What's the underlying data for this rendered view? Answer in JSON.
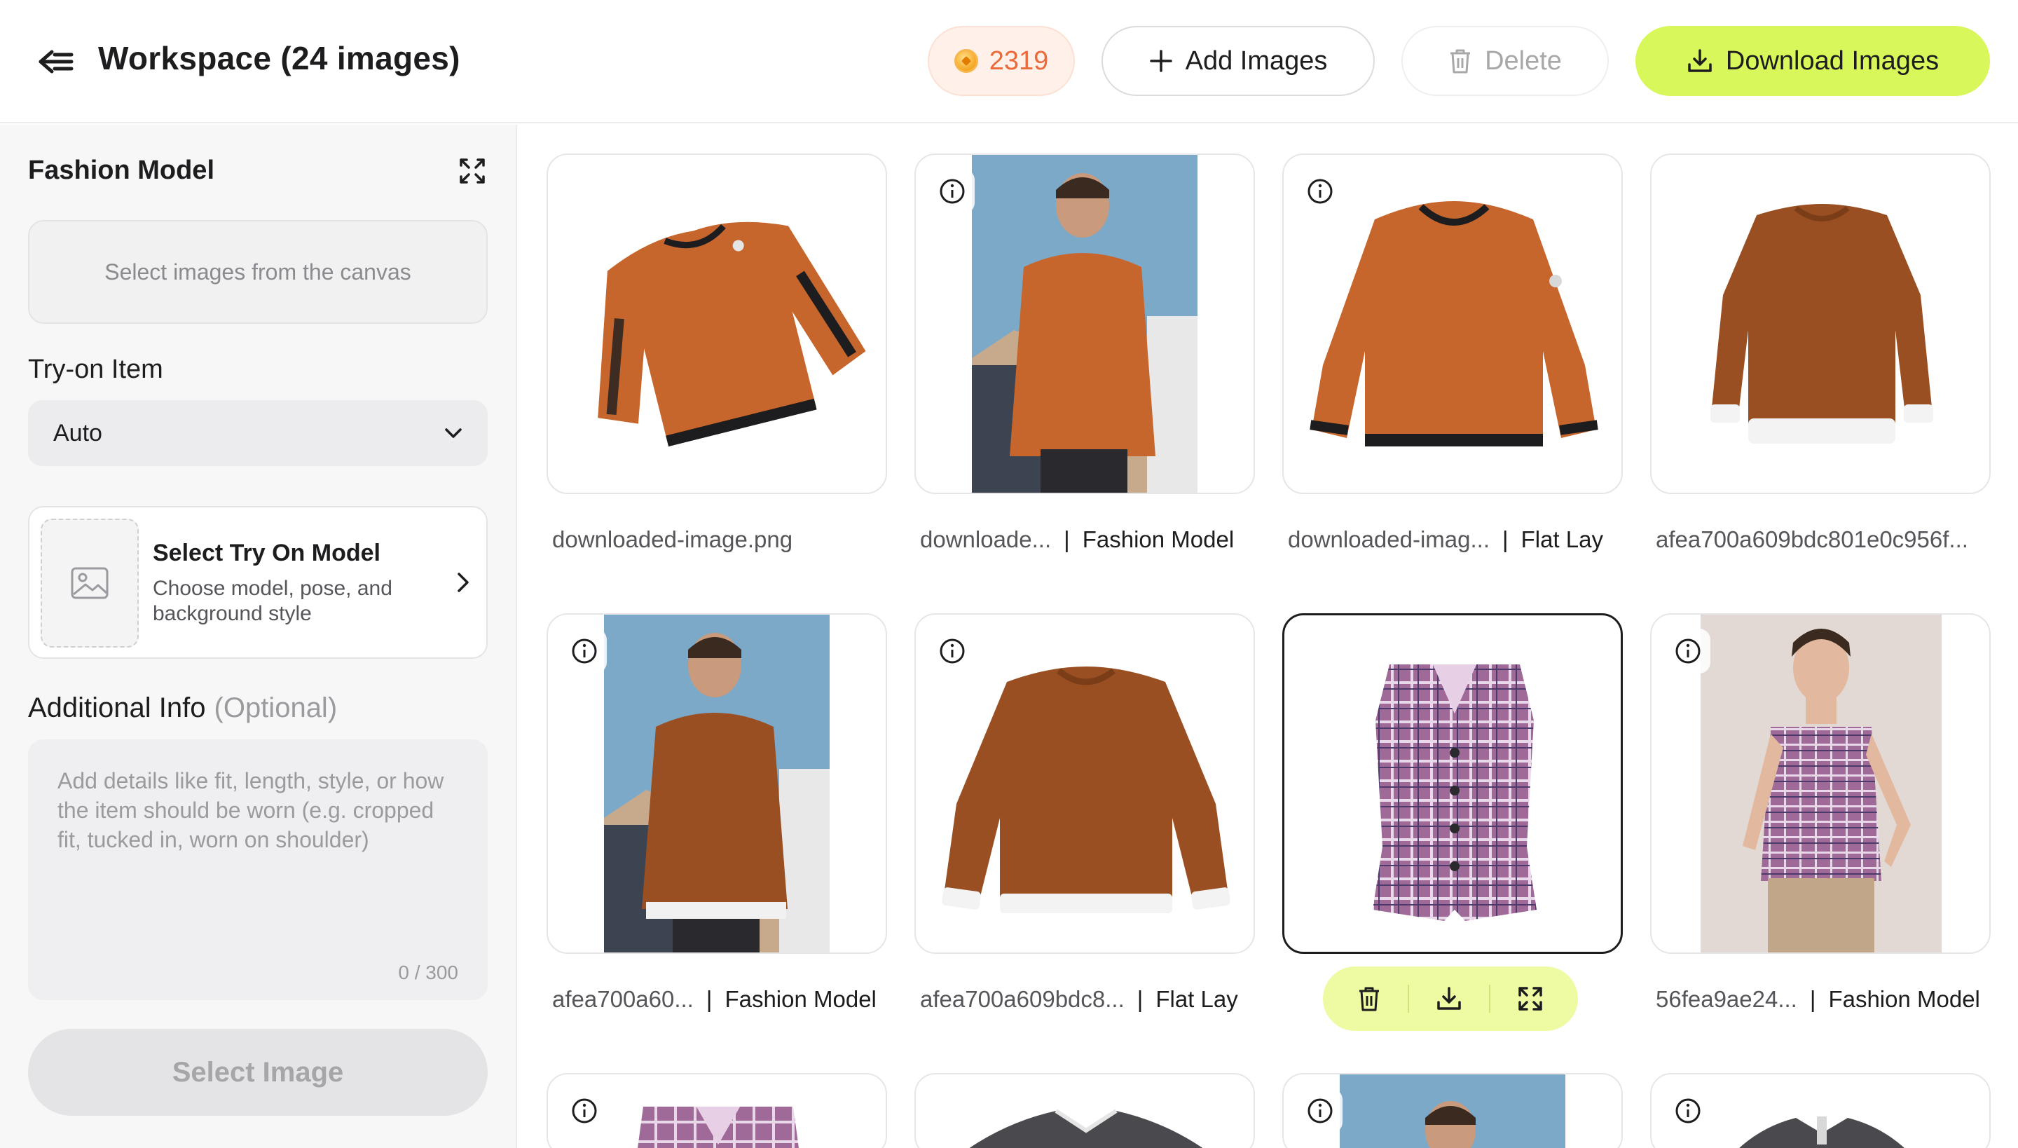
{
  "header": {
    "title": "Workspace (24 images)",
    "credits": "2319",
    "add_label": "Add Images",
    "delete_label": "Delete",
    "download_label": "Download Images"
  },
  "sidebar": {
    "title": "Fashion Model",
    "canvas_placeholder": "Select images from the canvas",
    "tryon_label": "Try-on Item",
    "tryon_value": "Auto",
    "model_title": "Select Try On Model",
    "model_sub": "Choose model, pose, and background style",
    "addl_label": "Additional Info",
    "addl_optional": "(Optional)",
    "addl_placeholder": "Add details like fit, length, style, or how the item should be worn (e.g. cropped fit, tucked in, worn on shoulder)",
    "counter": "0 / 300",
    "select_button": "Select Image"
  },
  "grid": {
    "items": [
      {
        "name": "downloaded-image.png",
        "tag": ""
      },
      {
        "name": "downloade...",
        "tag": "Fashion Model"
      },
      {
        "name": "downloaded-imag...",
        "tag": "Flat Lay"
      },
      {
        "name": "afea700a609bdc801e0c956f...",
        "tag": ""
      },
      {
        "name": "afea700a60...",
        "tag": "Fashion Model"
      },
      {
        "name": "afea700a609bdc8...",
        "tag": "Flat Lay"
      },
      {
        "name": "",
        "tag": ""
      },
      {
        "name": "56fea9ae24...",
        "tag": "Fashion Model"
      }
    ]
  },
  "colors": {
    "accent": "#d8f75a",
    "credits_text": "#ea6a3a",
    "sweater": "#c7662c",
    "sweater_brown": "#9a4f22",
    "vest": "#a06a98"
  }
}
